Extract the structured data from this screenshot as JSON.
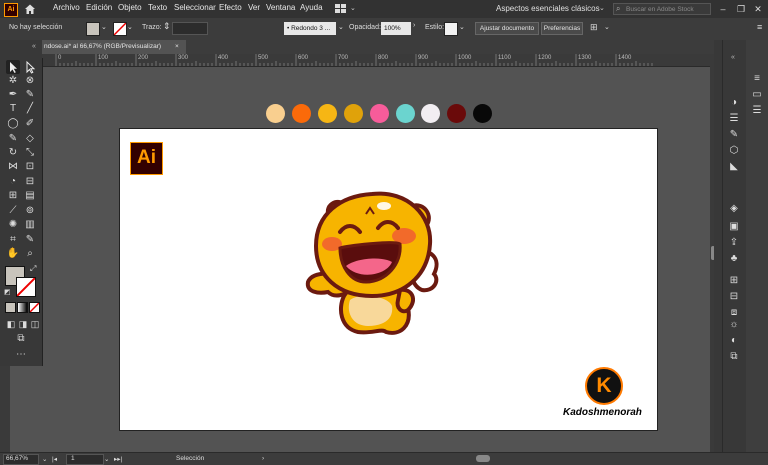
{
  "app": {
    "logo_text": "Ai",
    "menu": [
      "Archivo",
      "Edición",
      "Objeto",
      "Texto",
      "Seleccionar",
      "Efecto",
      "Ver",
      "Ventana",
      "Ayuda"
    ],
    "workspace": "Aspectos esenciales clásicos",
    "search_placeholder": "Buscar en Adobe Stock"
  },
  "control_bar": {
    "selection_state": "No hay selección",
    "stroke_label": "Trazo:",
    "brush_label": "Redondo 3 ...",
    "opacity_label": "Opacidad:",
    "opacity_value": "100%",
    "style_label": "Estilo:",
    "adjust_doc_button": "Ajustar documento",
    "preferences_button": "Preferencias"
  },
  "document": {
    "tab_title": "ndose.ai* al 66,67% (RGB/Previsualizar)",
    "close_icon": "×"
  },
  "ruler": {
    "ticks": [
      "0",
      "100",
      "200",
      "300",
      "400",
      "500",
      "600",
      "700",
      "800",
      "900",
      "1000",
      "1100",
      "1200",
      "1300",
      "1400"
    ]
  },
  "status_bar": {
    "zoom": "66,67%",
    "artboard_number": "1",
    "tool_name": "Selección"
  },
  "artwork": {
    "ai_badge": "Ai",
    "palette": [
      "#f9cf8f",
      "#fa6a0a",
      "#f6b614",
      "#e0a20a",
      "#f75c9a",
      "#6bd4cf",
      "#f2eef2",
      "#6a0a0a",
      "#080808"
    ],
    "k_logo_letter": "K",
    "brand_name": "Kadoshmenorah"
  },
  "colors": {
    "accent": "#ff9a00",
    "character_body": "#f7b400",
    "character_outline": "#6b1a10"
  }
}
